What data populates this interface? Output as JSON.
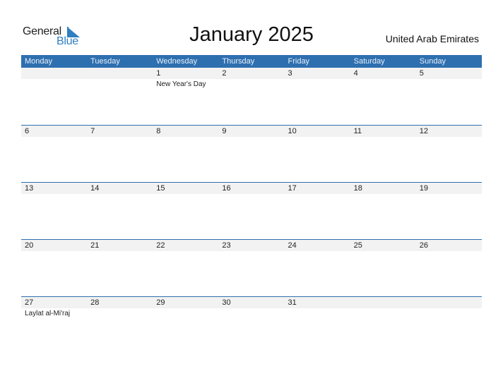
{
  "logo": {
    "word1": "General",
    "word2": "Blue"
  },
  "title": "January 2025",
  "country": "United Arab Emirates",
  "colors": {
    "accent": "#2e6fb0",
    "day_bg": "#f2f2f2"
  },
  "weekdays": [
    "Monday",
    "Tuesday",
    "Wednesday",
    "Thursday",
    "Friday",
    "Saturday",
    "Sunday"
  ],
  "weeks": [
    {
      "days": [
        {
          "n": "",
          "h": ""
        },
        {
          "n": "",
          "h": ""
        },
        {
          "n": "1",
          "h": "New Year's Day"
        },
        {
          "n": "2",
          "h": ""
        },
        {
          "n": "3",
          "h": ""
        },
        {
          "n": "4",
          "h": ""
        },
        {
          "n": "5",
          "h": ""
        }
      ]
    },
    {
      "days": [
        {
          "n": "6",
          "h": ""
        },
        {
          "n": "7",
          "h": ""
        },
        {
          "n": "8",
          "h": ""
        },
        {
          "n": "9",
          "h": ""
        },
        {
          "n": "10",
          "h": ""
        },
        {
          "n": "11",
          "h": ""
        },
        {
          "n": "12",
          "h": ""
        }
      ]
    },
    {
      "days": [
        {
          "n": "13",
          "h": ""
        },
        {
          "n": "14",
          "h": ""
        },
        {
          "n": "15",
          "h": ""
        },
        {
          "n": "16",
          "h": ""
        },
        {
          "n": "17",
          "h": ""
        },
        {
          "n": "18",
          "h": ""
        },
        {
          "n": "19",
          "h": ""
        }
      ]
    },
    {
      "days": [
        {
          "n": "20",
          "h": ""
        },
        {
          "n": "21",
          "h": ""
        },
        {
          "n": "22",
          "h": ""
        },
        {
          "n": "23",
          "h": ""
        },
        {
          "n": "24",
          "h": ""
        },
        {
          "n": "25",
          "h": ""
        },
        {
          "n": "26",
          "h": ""
        }
      ]
    },
    {
      "days": [
        {
          "n": "27",
          "h": "Laylat al-Mi'raj"
        },
        {
          "n": "28",
          "h": ""
        },
        {
          "n": "29",
          "h": ""
        },
        {
          "n": "30",
          "h": ""
        },
        {
          "n": "31",
          "h": ""
        },
        {
          "n": "",
          "h": ""
        },
        {
          "n": "",
          "h": ""
        }
      ]
    }
  ]
}
